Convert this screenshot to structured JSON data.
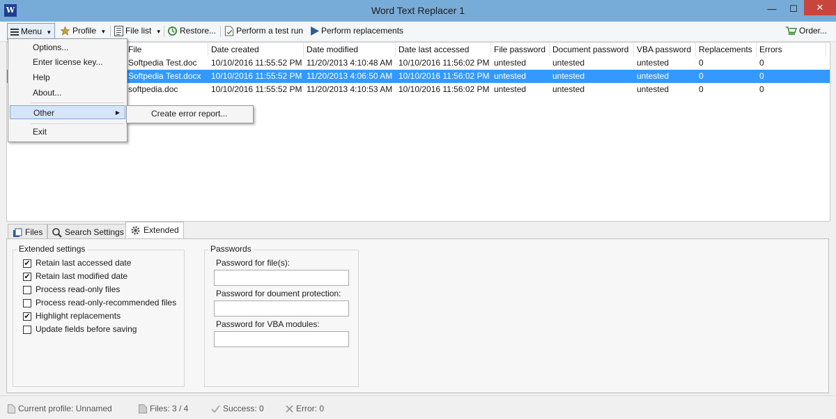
{
  "window": {
    "title": "Word Text Replacer 1",
    "app_icon_letter": "W",
    "minimize": "—",
    "maximize": "☐",
    "close": "✕"
  },
  "toolbar": {
    "menu": "Menu",
    "profile": "Profile",
    "file_list": "File list",
    "restore": "Restore...",
    "test_run": "Perform a test run",
    "perform": "Perform replacements",
    "order": "Order..."
  },
  "list": {
    "columns": [
      "File",
      "Date created",
      "Date modified",
      "Date last accessed",
      "File password",
      "Document password",
      "VBA password",
      "Replacements",
      "Errors"
    ],
    "rows": [
      [
        "Softpedia Test.doc",
        "10/10/2016 11:55:52 PM",
        "11/20/2013 4:10:48 AM",
        "10/10/2016 11:56:02 PM",
        "untested",
        "untested",
        "untested",
        "0",
        "0"
      ],
      [
        "Softpedia Test.docx",
        "10/10/2016 11:55:52 PM",
        "11/20/2013 4:06:50 AM",
        "10/10/2016 11:56:02 PM",
        "untested",
        "untested",
        "untested",
        "0",
        "0"
      ],
      [
        "softpedia.doc",
        "10/10/2016 11:55:52 PM",
        "11/20/2013 4:10:53 AM",
        "10/10/2016 11:56:02 PM",
        "untested",
        "untested",
        "untested",
        "0",
        "0"
      ]
    ],
    "selected_row": 1
  },
  "menu": {
    "items": [
      "Options...",
      "Enter license key...",
      "Help",
      "About...",
      "Other",
      "Exit"
    ],
    "submenu_item": "Create error report..."
  },
  "tabs": {
    "files": "Files",
    "search": "Search Settings",
    "extended": "Extended"
  },
  "extended": {
    "group_title": "Extended settings",
    "options": [
      {
        "label": "Retain last accessed date",
        "checked": true
      },
      {
        "label": "Retain last modified date",
        "checked": true
      },
      {
        "label": "Process read-only files",
        "checked": false
      },
      {
        "label": "Process read-only-recommended files",
        "checked": false
      },
      {
        "label": "Highlight replacements",
        "checked": true
      },
      {
        "label": "Update fields before saving",
        "checked": false
      }
    ]
  },
  "passwords": {
    "group_title": "Passwords",
    "file_label": "Password for file(s):",
    "doc_label": "Password for doument protection:",
    "vba_label": "Password for VBA modules:",
    "file_value": "",
    "doc_value": "",
    "vba_value": ""
  },
  "status": {
    "profile": "Current profile: Unnamed",
    "files": "Files: 3 / 4",
    "success": "Success: 0",
    "error": "Error: 0"
  },
  "colors": {
    "titlebar": "#78acd8",
    "selection": "#3399ff",
    "close_button": "#c7453a"
  }
}
